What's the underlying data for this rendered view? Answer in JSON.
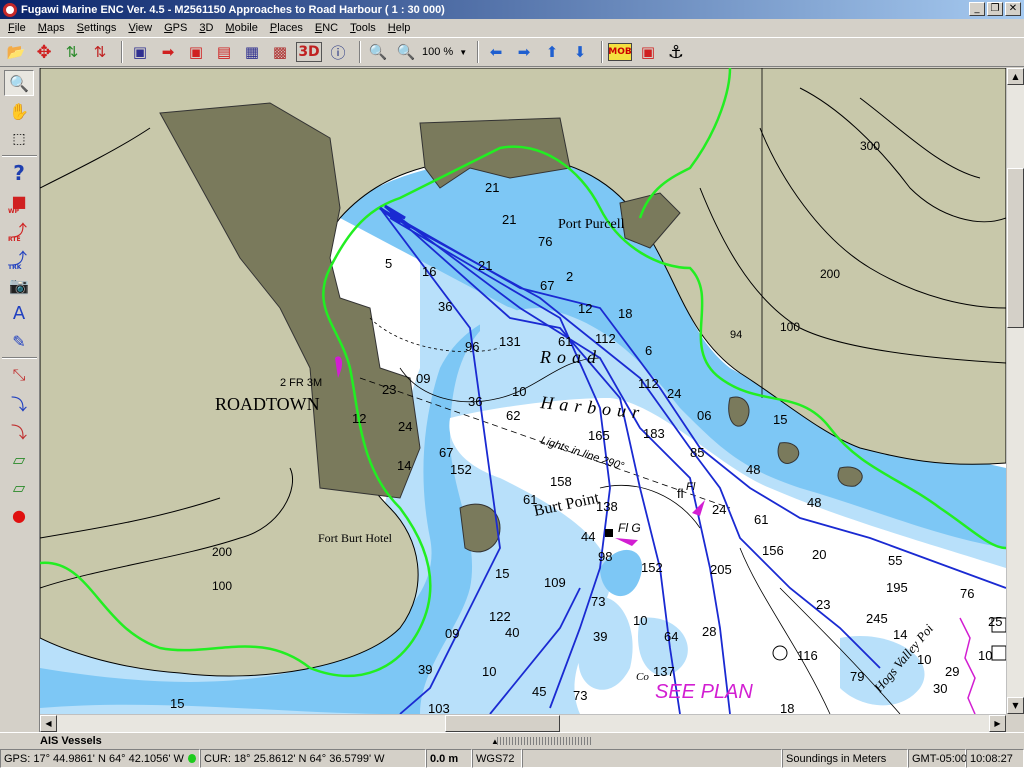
{
  "window": {
    "title": "Fugawi Marine ENC Ver. 4.5 - M2561150  Approaches to Road Harbour  ( 1 : 30 000)",
    "min": "_",
    "max": "❐",
    "close": "✕"
  },
  "menu": [
    "File",
    "Maps",
    "Settings",
    "View",
    "GPS",
    "3D",
    "Mobile",
    "Places",
    "ENC",
    "Tools",
    "Help"
  ],
  "toolbar": {
    "zoom": "100 %",
    "mob": "MOB",
    "three_d": "3D"
  },
  "left_tools": {
    "wp": "WP",
    "rte": "RTE",
    "trk": "TRK"
  },
  "map": {
    "places": {
      "roadtown": "ROADTOWN",
      "fort_burt_hotel": "Fort Burt Hotel",
      "port_purcell": "Port Purcell",
      "burt_point": "Burt Point",
      "road": "Road",
      "harbour": "Harbour",
      "hogs_valley": "Hogs Valley Poi",
      "co": "Co"
    },
    "annotations": {
      "light": "2 FR 3M",
      "flg": "Fl G",
      "fl": "Fl",
      "leading": "Lights in line 290°",
      "see_plan": "SEE PLAN"
    },
    "land_contours": [
      "300",
      "200",
      "100",
      "94",
      "200",
      "100"
    ],
    "soundings": [
      "21",
      "21",
      "76",
      "5",
      "16",
      "2",
      "21",
      "67",
      "12",
      "18",
      "131",
      "61",
      "112",
      "36",
      "96",
      "6",
      "23",
      "10",
      "09",
      "36",
      "62",
      "112",
      "24",
      "12",
      "24",
      "183",
      "67",
      "165",
      "06",
      "15",
      "14",
      "152",
      "85",
      "48",
      "158",
      "138",
      "61",
      "44",
      "98",
      "fl",
      "24",
      "61",
      "48",
      "152",
      "205",
      "15",
      "156",
      "20",
      "55",
      "195",
      "109",
      "73",
      "23",
      "245",
      "122",
      "39",
      "10",
      "64",
      "14",
      "09",
      "10",
      "40",
      "28",
      "116",
      "79",
      "10",
      "29",
      "39",
      "10",
      "137",
      "45",
      "73",
      "103",
      "15",
      "18",
      "30",
      "76",
      "25"
    ],
    "colors": {
      "land": "#c8c8aa",
      "developed": "#7a7a5c",
      "shallow": "#7dc7f5",
      "medium": "#b8e0fa",
      "deep": "#ffffff",
      "track_green": "#22ee22",
      "route_blue": "#1a2ad2",
      "magenta": "#d21ed2"
    }
  },
  "ais": {
    "label": "AIS Vessels"
  },
  "status": {
    "gps": "GPS: 17° 44.9861' N 64° 42.1056' W",
    "cur": "CUR: 18° 25.8612' N 64° 36.5799' W",
    "dist": "0.0 m",
    "datum": "WGS72",
    "soundings": "Soundings in Meters",
    "tz": "GMT-05:00",
    "time": "10:08:27"
  }
}
